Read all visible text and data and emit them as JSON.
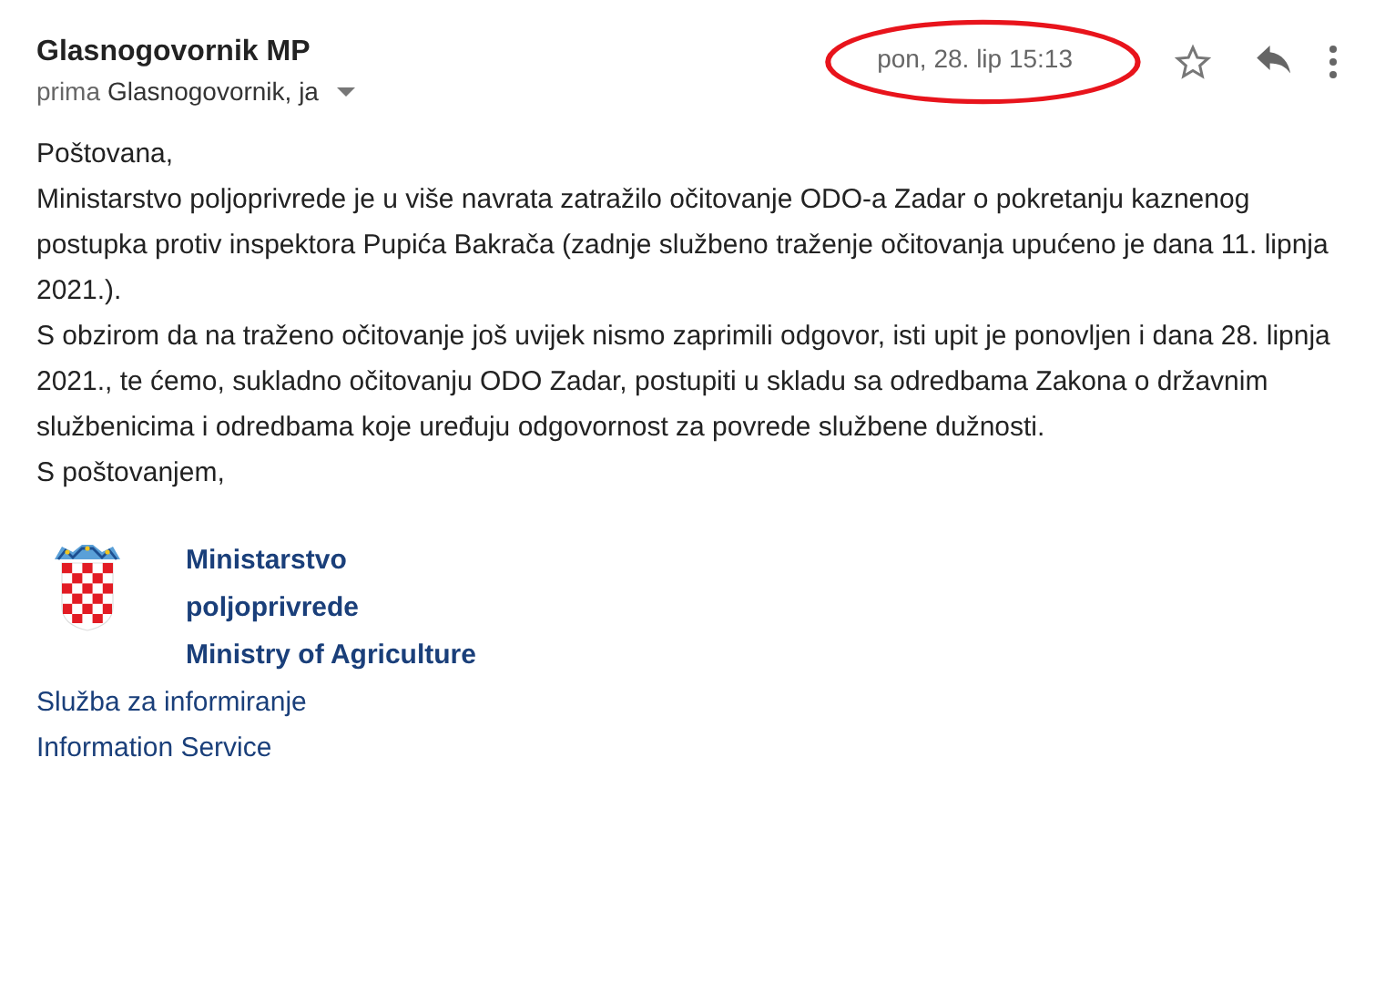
{
  "header": {
    "sender": "Glasnogovornik MP",
    "recipient_prefix": "prima",
    "recipients": "Glasnogovornik, ja",
    "date": "pon, 28. lip 15:13",
    "date_circled": true,
    "starred": false
  },
  "body": {
    "greeting": "Poštovana,",
    "paragraphs": [
      "Ministarstvo poljoprivrede je u više navrata zatražilo očitovanje ODO-a Zadar o pokretanju kaznenog postupka protiv inspektora Pupića Bakrača (zadnje službeno traženje očitovanja upućeno je dana 11. lipnja 2021.).",
      "S obzirom da na traženo očitovanje još uvijek nismo zaprimili odgovor, isti upit je ponovljen i dana 28. lipnja 2021., te ćemo, sukladno očitovanju ODO Zadar, postupiti u skladu sa odredbama Zakona o državnim službenicima i odredbama koje uređuju odgovornost za povrede službene dužnosti."
    ],
    "closing": "S poštovanjem,"
  },
  "signature": {
    "org_lines": [
      "Ministarstvo",
      "poljoprivrede",
      "Ministry of Agriculture"
    ],
    "service_lines": [
      "Služba za informiranje",
      "Information Service"
    ]
  }
}
